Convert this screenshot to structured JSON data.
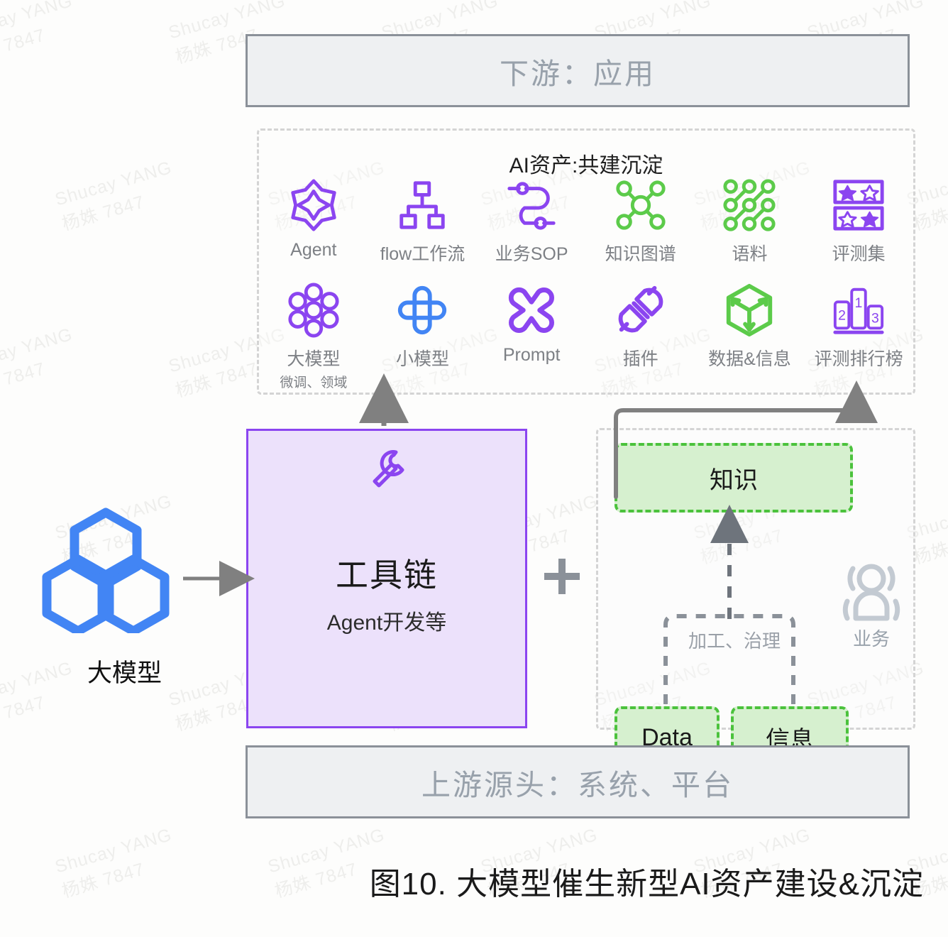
{
  "figure": {
    "caption": "图10. 大模型催生新型AI资产建设&沉淀"
  },
  "banners": {
    "downstream": "下游：应用",
    "upstream": "上游源头：系统、平台"
  },
  "assets": {
    "title": "AI资产:共建沉淀",
    "row1": [
      {
        "icon": "agent-star-icon",
        "label": "Agent",
        "color": "#8b45f0"
      },
      {
        "icon": "flow-hierarchy-icon",
        "label": "flow工作流",
        "color": "#8b45f0"
      },
      {
        "icon": "sop-path-icon",
        "label": "业务SOP",
        "color": "#8b45f0"
      },
      {
        "icon": "knowledge-graph-icon",
        "label": "知识图谱",
        "color": "#5ccb4a"
      },
      {
        "icon": "corpus-dots-icon",
        "label": "语料",
        "color": "#5ccb4a"
      },
      {
        "icon": "eval-set-stars-icon",
        "label": "评测集",
        "color": "#8b45f0"
      }
    ],
    "row2": [
      {
        "icon": "big-model-atom-icon",
        "label": "大模型",
        "sub": "微调、领域",
        "color": "#8b45f0"
      },
      {
        "icon": "small-model-icon",
        "label": "小模型",
        "sub": "",
        "color": "#4285f4"
      },
      {
        "icon": "prompt-knot-icon",
        "label": "Prompt",
        "sub": "",
        "color": "#8b45f0"
      },
      {
        "icon": "plugin-icon",
        "label": "插件",
        "sub": "",
        "color": "#8b45f0"
      },
      {
        "icon": "data-cube-icon",
        "label": "数据&信息",
        "sub": "",
        "color": "#5ccb4a"
      },
      {
        "icon": "leaderboard-icon",
        "label": "评测排行榜",
        "sub": "",
        "color": "#8b45f0"
      }
    ]
  },
  "toolchain": {
    "icon": "wrench-icon",
    "title": "工具链",
    "subtitle": "Agent开发等"
  },
  "plus_symbol": "+",
  "knowledge": {
    "knowledge_label": "知识",
    "data_label": "Data",
    "info_label": "信息",
    "process_label": "加工、治理",
    "business_label": "业务",
    "business_icon": "business-user-icon"
  },
  "model": {
    "icon": "hexagon-cluster-icon",
    "label": "大模型"
  },
  "colors": {
    "purple": "#8b45f0",
    "green": "#5ccb4a",
    "blue": "#4285f4",
    "grey_banner_bg": "#eef0f2",
    "grey_banner_border": "#8b9199",
    "grey_banner_text": "#98a1ab",
    "toolchain_bg": "#ece1fb",
    "green_box_bg": "#d6f0cf",
    "green_box_border": "#4bc23c",
    "arrow_grey": "#808080"
  },
  "watermark": {
    "line1": "Shucay YANG",
    "line2": "杨姝 7847"
  }
}
